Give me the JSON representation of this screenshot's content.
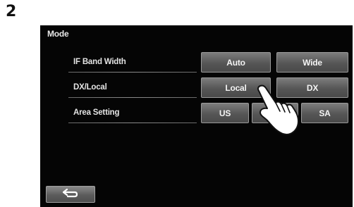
{
  "step_number": "2",
  "screen": {
    "title": "Mode",
    "rows": [
      {
        "label": "IF Band Width",
        "options": [
          "Auto",
          "Wide"
        ]
      },
      {
        "label": "DX/Local",
        "options": [
          "Local",
          "DX"
        ]
      },
      {
        "label": "Area Setting",
        "options": [
          "US",
          "",
          "SA"
        ]
      }
    ],
    "back_icon": "return-arrow-icon"
  },
  "illustration": {
    "icon": "pointing-hand-icon"
  }
}
